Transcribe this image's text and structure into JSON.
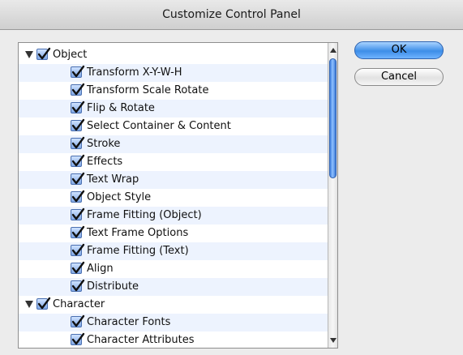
{
  "window": {
    "title": "Customize Control Panel"
  },
  "buttons": {
    "ok_label": "OK",
    "cancel_label": "Cancel"
  },
  "tree": {
    "items": [
      {
        "label": "Object",
        "level": 0,
        "expanded": true,
        "checked": true
      },
      {
        "label": "Transform X-Y-W-H",
        "level": 1,
        "checked": true
      },
      {
        "label": "Transform Scale Rotate",
        "level": 1,
        "checked": true
      },
      {
        "label": "Flip & Rotate",
        "level": 1,
        "checked": true
      },
      {
        "label": "Select Container & Content",
        "level": 1,
        "checked": true
      },
      {
        "label": "Stroke",
        "level": 1,
        "checked": true
      },
      {
        "label": "Effects",
        "level": 1,
        "checked": true
      },
      {
        "label": "Text Wrap",
        "level": 1,
        "checked": true
      },
      {
        "label": "Object Style",
        "level": 1,
        "checked": true
      },
      {
        "label": "Frame Fitting (Object)",
        "level": 1,
        "checked": true
      },
      {
        "label": "Text Frame Options",
        "level": 1,
        "checked": true
      },
      {
        "label": "Frame Fitting (Text)",
        "level": 1,
        "checked": true
      },
      {
        "label": "Align",
        "level": 1,
        "checked": true
      },
      {
        "label": "Distribute",
        "level": 1,
        "checked": true
      },
      {
        "label": "Character",
        "level": 0,
        "expanded": true,
        "checked": true
      },
      {
        "label": "Character Fonts",
        "level": 1,
        "checked": true
      },
      {
        "label": "Character Attributes",
        "level": 1,
        "checked": true
      }
    ]
  },
  "colors": {
    "checkbox": "#6f9be0",
    "default_button": "#3d8ee8",
    "row_stripe": "#edf3fe"
  }
}
